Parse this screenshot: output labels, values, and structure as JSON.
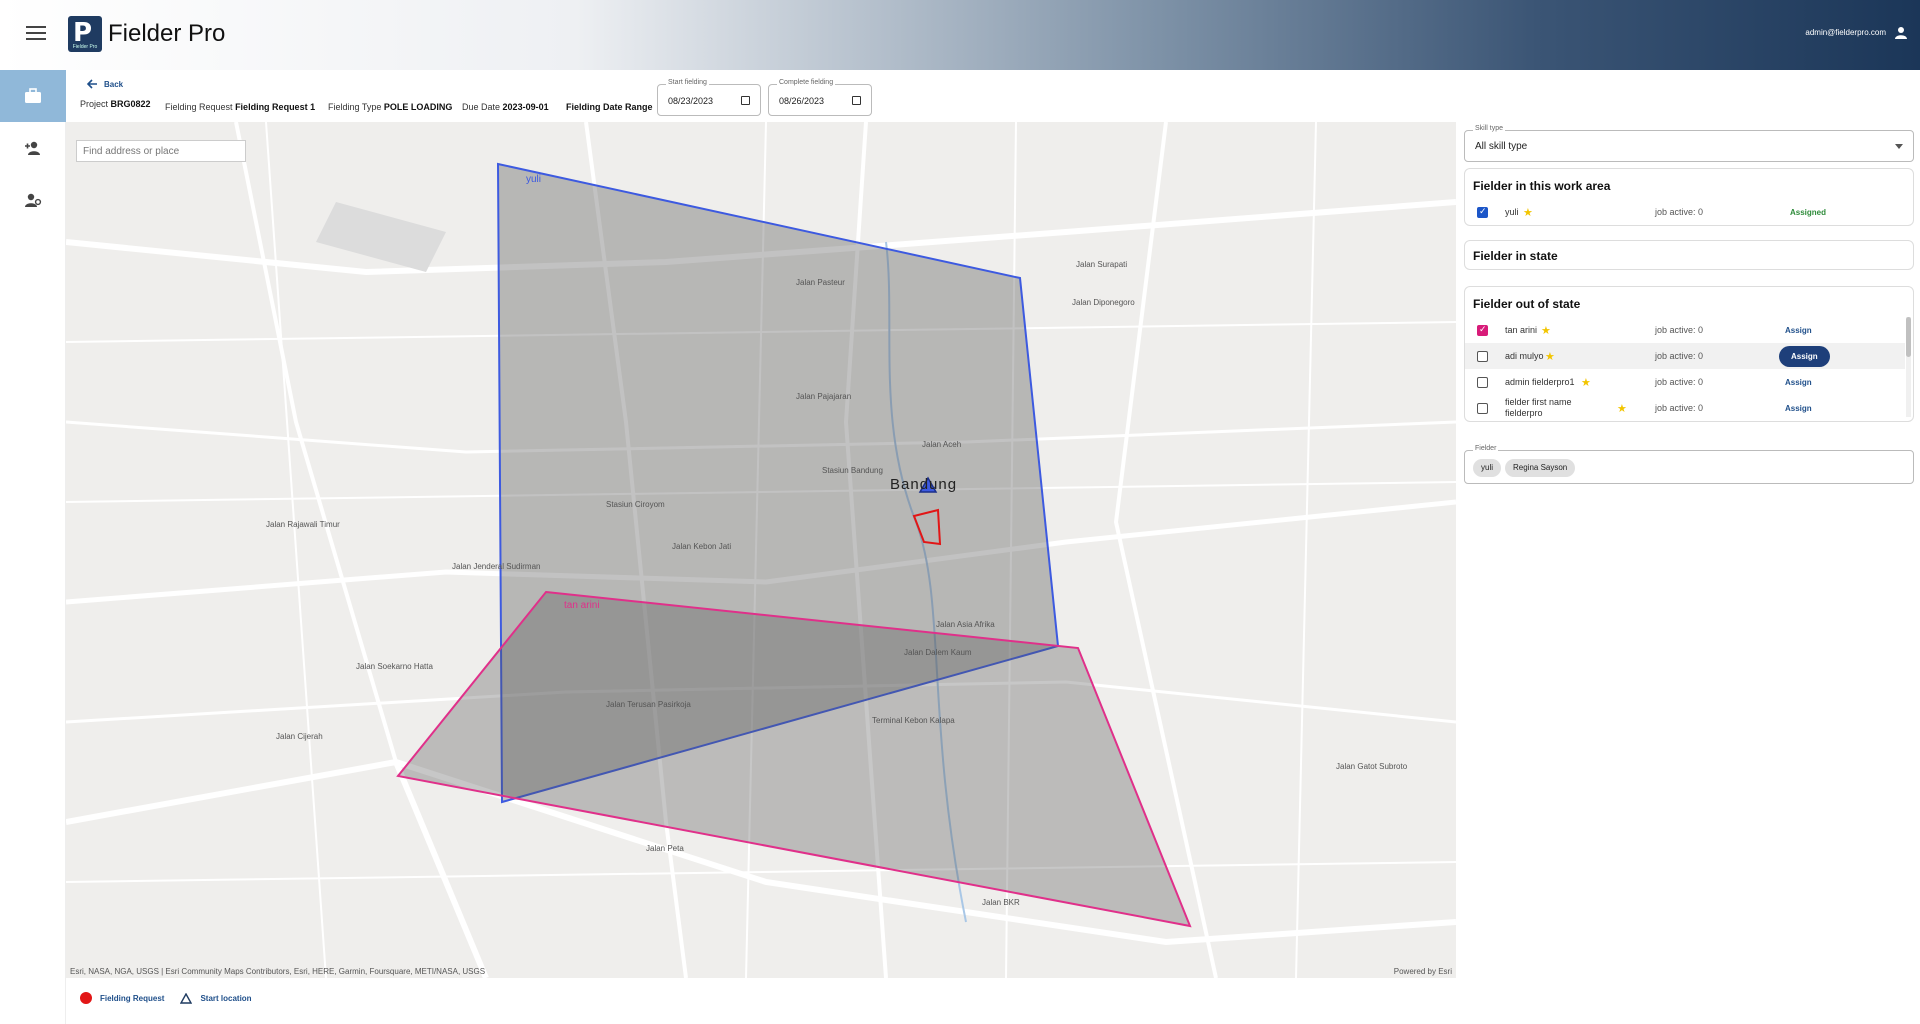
{
  "app": {
    "title": "Fielder Pro",
    "logo_sub": "Fielder Pro",
    "user_email": "admin@fielderpro.com"
  },
  "nav": {
    "back_label": "Back"
  },
  "project": {
    "project_label": "Project",
    "project_value": "BRG0822",
    "request_label": "Fielding Request",
    "request_value": "Fielding Request 1",
    "type_label": "Fielding Type",
    "type_value": "POLE LOADING",
    "due_label": "Due Date",
    "due_value": "2023-09-01",
    "range_label": "Fielding Date Range",
    "start_label": "Start fielding",
    "start_value": "08/23/2023",
    "complete_label": "Complete fielding",
    "complete_value": "08/26/2023"
  },
  "map": {
    "search_placeholder": "Find address or place",
    "city": "Bandung",
    "area_yuli": "yuli",
    "area_tan": "tan arini",
    "attribution": "Esri, NASA, NGA, USGS | Esri Community Maps Contributors, Esri, HERE, Garmin, Foursquare, METI/NASA, USGS",
    "powered": "Powered by Esri",
    "labels": [
      {
        "t": "Jalan Pasteur"
      },
      {
        "t": "Jalan Surapati"
      },
      {
        "t": "Jalan Pajajaran"
      },
      {
        "t": "Jalan Aceh"
      },
      {
        "t": "Jalan Jenderal Sudirman"
      },
      {
        "t": "Jalan Kebon Jati"
      },
      {
        "t": "Jalan Terusan Pasirkoja"
      },
      {
        "t": "Jalan Dalem Kaum"
      },
      {
        "t": "Jalan Asia Afrika"
      },
      {
        "t": "Jalan Diponegoro"
      },
      {
        "t": "Jalan Peta"
      },
      {
        "t": "Jalan BKR"
      },
      {
        "t": "Jalan Cijerah"
      },
      {
        "t": "Jalan Soekarno Hatta"
      },
      {
        "t": "Jalan Rajawali Timur"
      },
      {
        "t": "Stasiun Bandung"
      },
      {
        "t": "Stasiun Ciroyom"
      },
      {
        "t": "Terminal Kebon Kalapa"
      },
      {
        "t": "Jalan Gatot Subroto"
      }
    ]
  },
  "legend": {
    "request": "Fielding Request",
    "start": "Start location"
  },
  "panel": {
    "skill_label": "Skill type",
    "skill_value": "All skill type",
    "work_area_title": "Fielder in this work area",
    "in_state_title": "Fielder in state",
    "out_state_title": "Fielder out of state",
    "work_area": [
      {
        "name": "yuli",
        "job": "job active: 0",
        "status": "Assigned"
      }
    ],
    "out_state": [
      {
        "name": "tan arini",
        "job": "job active: 0",
        "action": "Assign"
      },
      {
        "name": "adi mulyo",
        "job": "job active: 0",
        "action": "Assign"
      },
      {
        "name": "admin fielderpro1",
        "job": "job active: 0",
        "action": "Assign"
      },
      {
        "name": "fielder first name",
        "name2": "fielderpro",
        "job": "job active: 0",
        "action": "Assign"
      }
    ],
    "fielder_label": "Fielder",
    "chips": [
      "yuli",
      "Regina Sayson"
    ]
  },
  "colors": {
    "header_dark": "#1b3658",
    "accent": "#1e3f7a",
    "area_blue": "#3d5ae0",
    "area_pink": "#e0308a",
    "request_red": "#e21616"
  }
}
